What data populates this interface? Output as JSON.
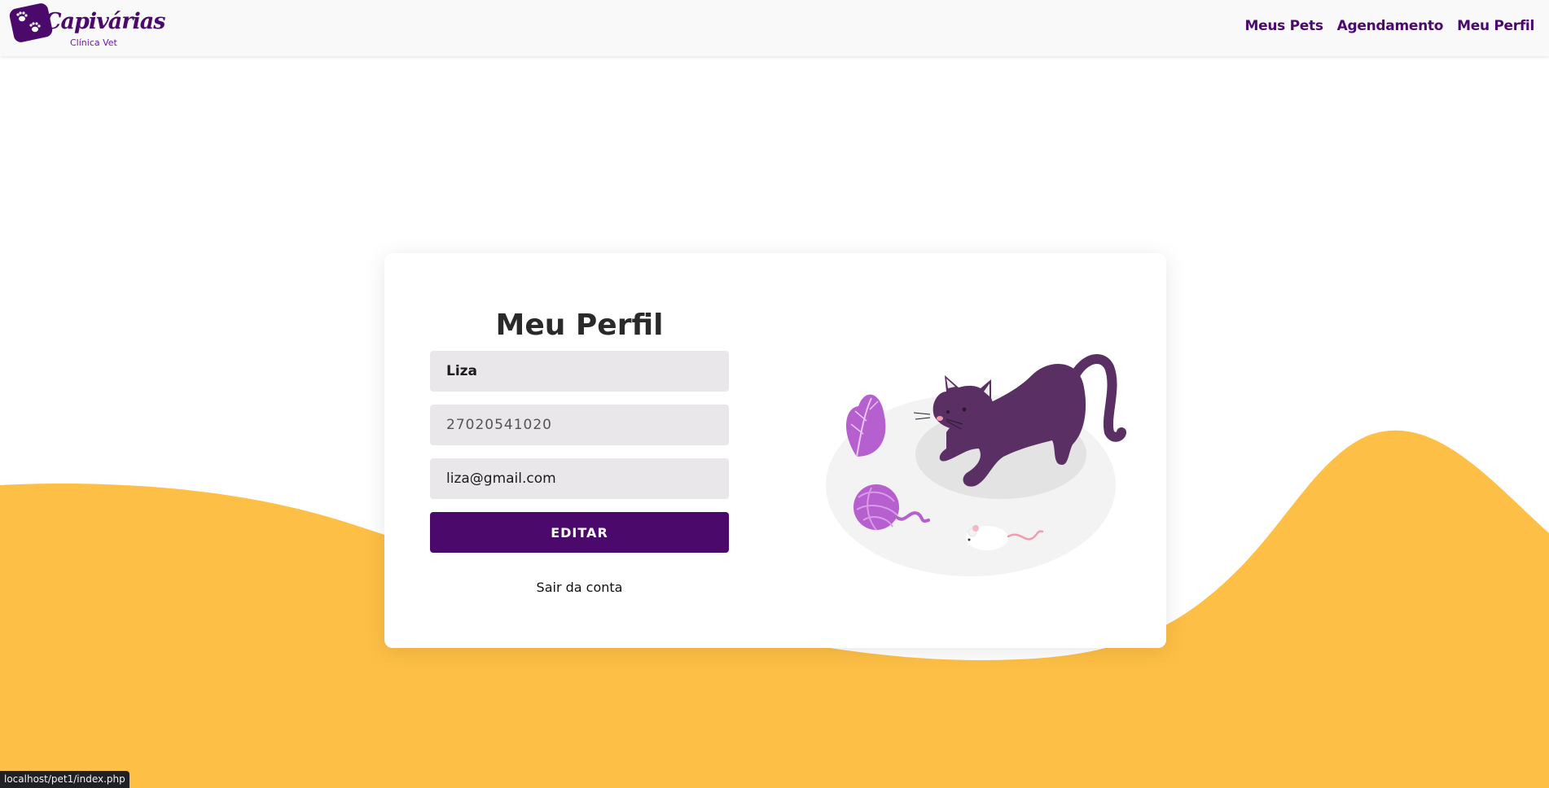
{
  "brand": {
    "name": "Capivárias",
    "subtitle": "Clínica Vet",
    "logo_icon": "paw-prints-icon",
    "primary_color": "#4b0a6b",
    "accent_color": "#fdbf45"
  },
  "nav": {
    "items": [
      {
        "label": "Meus Pets"
      },
      {
        "label": "Agendamento"
      },
      {
        "label": "Meu Perfil"
      }
    ]
  },
  "profile": {
    "title": "Meu Perfil",
    "name": "Liza",
    "phone": "27020541020",
    "email": "liza@gmail.com",
    "edit_label": "EDITAR",
    "logout_label": "Sair da conta"
  },
  "status_bar": {
    "url": "localhost/pet1/index.php"
  }
}
